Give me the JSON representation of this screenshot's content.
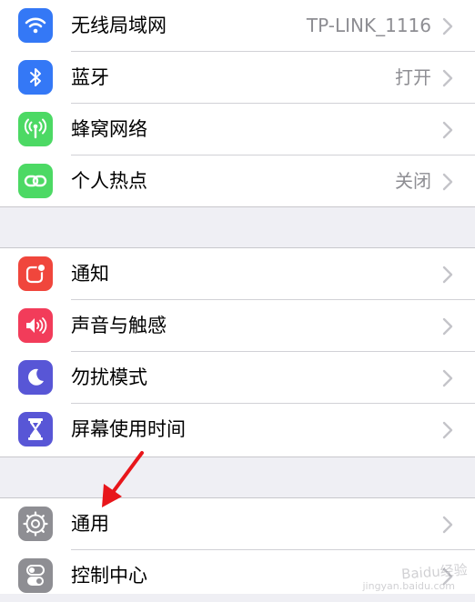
{
  "colors": {
    "wifi": "#3478f6",
    "bluetooth": "#3478f6",
    "cellular": "#4cd964",
    "hotspot": "#4cd964",
    "notifications": "#f0463c",
    "sounds": "#f23c5a",
    "dnd": "#5856d6",
    "screentime": "#5856d6",
    "general": "#8e8e93",
    "control_center": "#8e8e93",
    "annotation_arrow": "#e8161b"
  },
  "group1": [
    {
      "label": "无线局域网",
      "value": "TP-LINK_1116",
      "icon": "wifi-icon"
    },
    {
      "label": "蓝牙",
      "value": "打开",
      "icon": "bluetooth-icon"
    },
    {
      "label": "蜂窝网络",
      "value": "",
      "icon": "antenna-icon"
    },
    {
      "label": "个人热点",
      "value": "关闭",
      "icon": "link-icon"
    }
  ],
  "group2": [
    {
      "label": "通知",
      "icon": "notification-badge-icon"
    },
    {
      "label": "声音与触感",
      "icon": "speaker-icon"
    },
    {
      "label": "勿扰模式",
      "icon": "moon-icon"
    },
    {
      "label": "屏幕使用时间",
      "icon": "hourglass-icon"
    }
  ],
  "group3": [
    {
      "label": "通用",
      "icon": "gear-icon"
    },
    {
      "label": "控制中心",
      "icon": "toggles-icon"
    }
  ],
  "watermark": {
    "text": "Baidu经验",
    "sub": "jingyan.baidu.com"
  }
}
